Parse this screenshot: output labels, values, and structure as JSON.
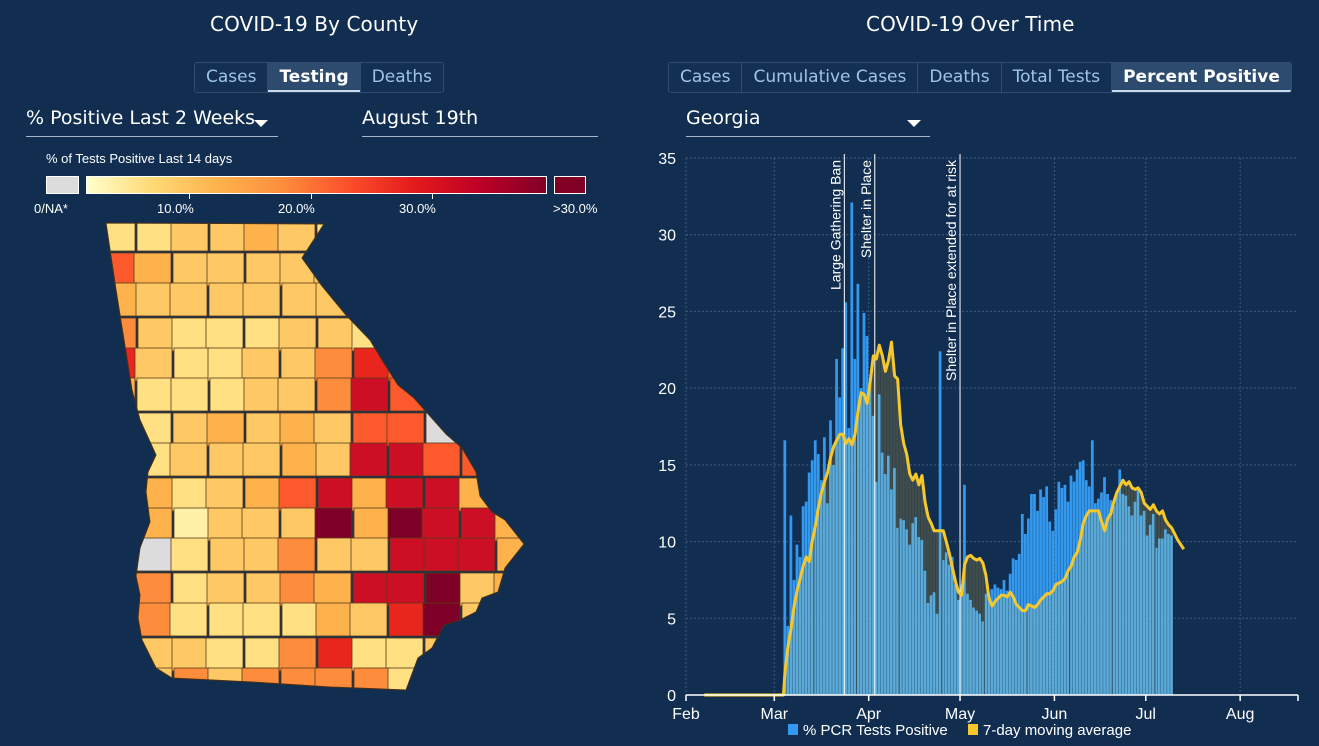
{
  "left_panel": {
    "title": "COVID-19 By County",
    "tabs": [
      {
        "label": "Cases",
        "active": false
      },
      {
        "label": "Testing",
        "active": true
      },
      {
        "label": "Deaths",
        "active": false
      }
    ],
    "metric_select": {
      "value": "% Positive Last 2 Weeks",
      "icon": "caret-down-icon"
    },
    "date_select": {
      "value": "August 19th"
    },
    "legend": {
      "title": "% of Tests Positive Last 14 days",
      "na_label": "0/NA*",
      "ticks": [
        "10.0%",
        "20.0%",
        "30.0%"
      ],
      "over_label": ">30.0%",
      "colors": {
        "na": "#dcdcdc",
        "gradient": [
          "#ffffcc",
          "#fed976",
          "#feb24c",
          "#fd8d3c",
          "#fc4e2a",
          "#e31a1c",
          "#bd0026",
          "#800026"
        ],
        "over": "#800026"
      }
    },
    "map": {
      "region": "Georgia",
      "value_colors_by_bucket": {
        "na": "#dcdcdc",
        "very_low": "#fff2a8",
        "low": "#ffe083",
        "low_mid": "#fec964",
        "mid": "#feb24c",
        "mid_high": "#fd8d3c",
        "high": "#fc5a2d",
        "very_high": "#e8261e",
        "severe": "#cc0f24",
        "extreme": "#7f0026"
      }
    }
  },
  "right_panel": {
    "title": "COVID-19 Over Time",
    "tabs": [
      {
        "label": "Cases",
        "active": false
      },
      {
        "label": "Cumulative Cases",
        "active": false
      },
      {
        "label": "Deaths",
        "active": false
      },
      {
        "label": "Total Tests",
        "active": false
      },
      {
        "label": "Percent Positive",
        "active": true
      }
    ],
    "region_select": {
      "value": "Georgia",
      "icon": "caret-down-icon"
    }
  },
  "chart_data": {
    "type": "bar",
    "title": "COVID-19 Over Time — Percent Positive (Georgia)",
    "xlabel": "",
    "ylabel": "",
    "ylim": [
      0,
      35
    ],
    "yticks": [
      0,
      5,
      10,
      15,
      20,
      25,
      30,
      35
    ],
    "xticks": [
      "Feb",
      "Mar",
      "Apr",
      "May",
      "Jun",
      "Jul",
      "Aug"
    ],
    "x_range": [
      "2020-02-01",
      "2020-08-19"
    ],
    "grid": true,
    "legend_position": "bottom",
    "annotations": [
      {
        "date": "2020-03-24",
        "label": "Large Gathering Ban"
      },
      {
        "date": "2020-04-03",
        "label": "Shelter in Place"
      },
      {
        "date": "2020-05-01",
        "label": "Shelter in Place extended for at risk"
      }
    ],
    "series": [
      {
        "name": "% PCR Tests Positive",
        "color": "#3399ee",
        "start_date": "2020-03-04",
        "values": [
          16.6,
          4.5,
          11.7,
          7.5,
          9.8,
          9.0,
          12.3,
          12.6,
          14.5,
          15.3,
          16.6,
          15.7,
          14.0,
          16.8,
          12.5,
          17.9,
          15.0,
          21.9,
          19.4,
          22.6,
          25.6,
          17.4,
          32.1,
          21.9,
          26.8,
          20.0,
          24.9,
          23.4,
          20.3,
          18.2,
          13.9,
          19.6,
          15.8,
          14.4,
          15.6,
          13.4,
          14.8,
          10.9,
          11.5,
          11.4,
          10.8,
          9.8,
          11.2,
          11.6,
          10.3,
          10.1,
          8.1,
          6.0,
          6.5,
          6.7,
          5.3,
          22.4,
          8.8,
          9.3,
          8.5,
          9.0,
          7.2,
          6.2,
          7.2,
          13.7,
          6.6,
          6.2,
          5.7,
          5.5,
          5.3,
          4.8,
          6.6,
          6.3,
          6.9,
          7.2,
          7.0,
          6.9,
          7.5,
          6.8,
          7.9,
          8.9,
          8.8,
          9.2,
          11.8,
          10.5,
          11.5,
          13.1,
          13.1,
          12.0,
          13.4,
          12.9,
          13.6,
          11.3,
          10.7,
          12.1,
          13.9,
          13.5,
          13.7,
          12.6,
          14.3,
          13.9,
          14.7,
          15.2,
          15.3,
          14.0,
          13.6,
          16.6,
          12.5,
          12.8,
          13.2,
          14.2,
          13.1,
          12.7,
          12.3,
          13.2,
          14.7,
          13.1,
          13.0,
          12.3,
          11.7,
          12.6,
          13.5,
          11.7,
          12.0,
          10.4,
          11.1,
          11.8,
          9.6,
          10.2,
          10.2,
          10.8,
          10.5,
          10.4
        ]
      },
      {
        "name": "7-day moving average",
        "color": "#f6c82b",
        "start_date": "2020-03-04",
        "values": [
          1.5,
          3.2,
          4.3,
          5.8,
          6.8,
          7.6,
          8.4,
          9.0,
          8.7,
          10.1,
          11.0,
          12.2,
          13.2,
          13.9,
          14.5,
          15.5,
          16.2,
          16.6,
          17.0,
          17.0,
          16.4,
          16.7,
          16.3,
          17.0,
          18.5,
          19.7,
          19.6,
          19.0,
          20.4,
          22.1,
          21.9,
          22.8,
          22.1,
          21.1,
          21.8,
          23.0,
          20.8,
          20.6,
          17.6,
          16.4,
          15.7,
          14.4,
          14.0,
          14.4,
          13.7,
          14.3,
          12.6,
          11.6,
          11.2,
          10.7,
          10.7,
          10.7,
          10.7,
          10.0,
          9.2,
          8.3,
          7.4,
          6.7,
          6.5,
          8.5,
          9.0,
          9.1,
          8.9,
          8.8,
          8.9,
          8.6,
          7.8,
          6.3,
          5.8,
          6.1,
          6.3,
          6.5,
          6.5,
          6.4,
          6.7,
          6.4,
          5.9,
          5.7,
          5.5,
          5.5,
          5.9,
          5.8,
          5.7,
          5.9,
          6.2,
          6.4,
          6.6,
          6.6,
          6.8,
          7.2,
          7.3,
          7.4,
          7.6,
          8.1,
          8.4,
          9.0,
          9.3,
          10.1,
          11.2,
          11.7,
          12.0,
          12.0,
          12.0,
          12.0,
          11.3,
          10.7,
          11.5,
          11.8,
          12.6,
          13.2,
          13.6,
          14.0,
          13.7,
          13.9,
          13.5,
          13.4,
          13.5,
          13.2,
          12.5,
          12.3,
          12.1,
          12.4,
          12.0,
          11.8,
          12.0,
          11.4,
          11.1,
          10.9,
          10.5,
          10.1,
          9.8,
          9.5
        ]
      }
    ],
    "legend": [
      {
        "label": "% PCR Tests Positive",
        "color": "#3399ee"
      },
      {
        "label": "7-day moving average",
        "color": "#f6c82b"
      }
    ]
  }
}
